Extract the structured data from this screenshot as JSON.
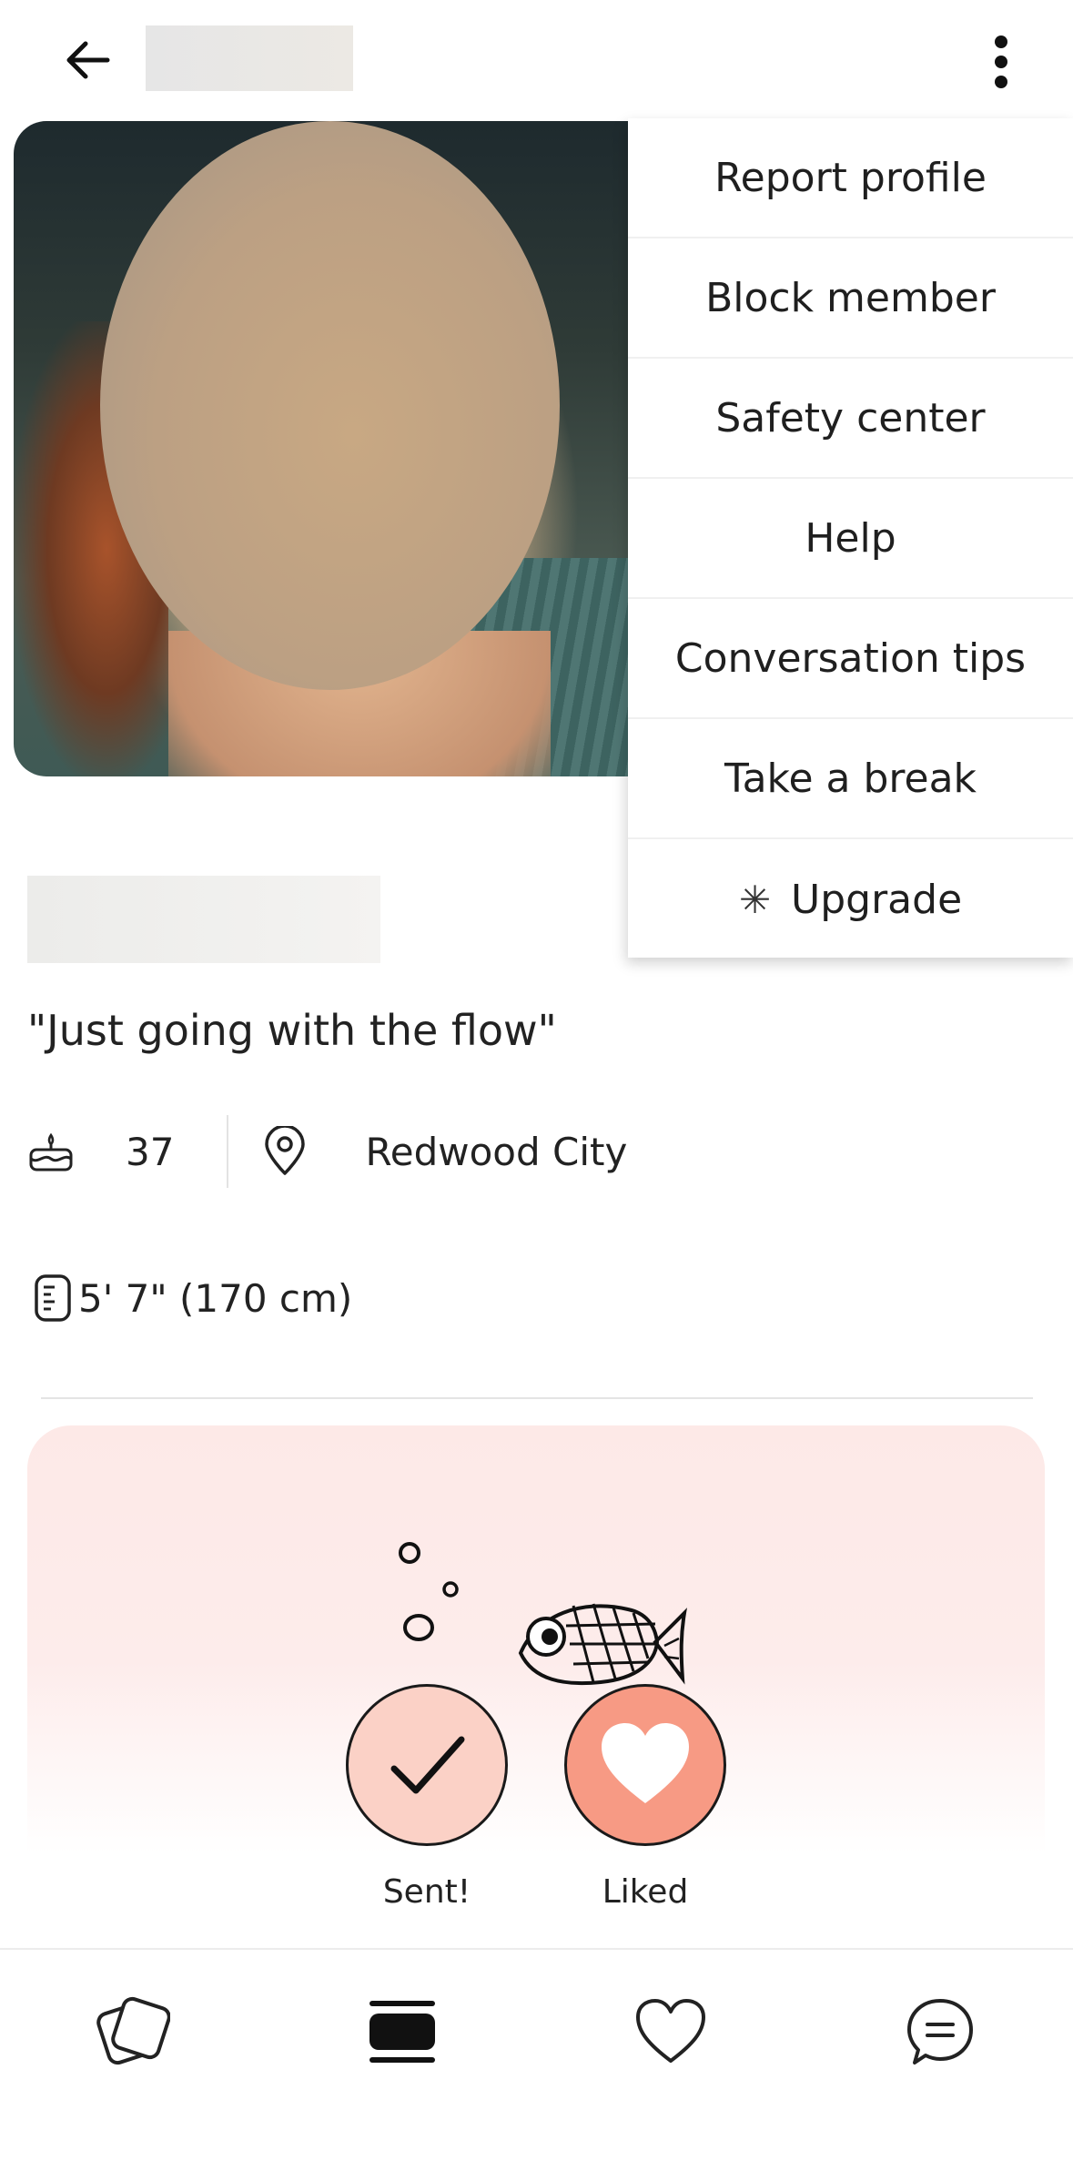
{
  "menu": {
    "items": [
      {
        "label": "Report profile"
      },
      {
        "label": "Block member"
      },
      {
        "label": "Safety center"
      },
      {
        "label": "Help"
      },
      {
        "label": "Conversation tips"
      },
      {
        "label": "Take a break"
      },
      {
        "label": "Upgrade",
        "icon": "asterisk-icon"
      }
    ]
  },
  "profile": {
    "quote": "\"Just going with the flow\"",
    "age": "37",
    "location": "Redwood City",
    "height": "5' 7\" (170 cm)"
  },
  "actions": {
    "sent_label": "Sent!",
    "liked_label": "Liked"
  },
  "nav": {
    "icons": [
      "discover-icon",
      "profile-cards-icon",
      "likes-heart-icon",
      "chat-icon"
    ]
  },
  "colors": {
    "card_bg": "#fde9e7",
    "sent_circle": "#fbd1c6",
    "liked_circle": "#f79a84"
  }
}
